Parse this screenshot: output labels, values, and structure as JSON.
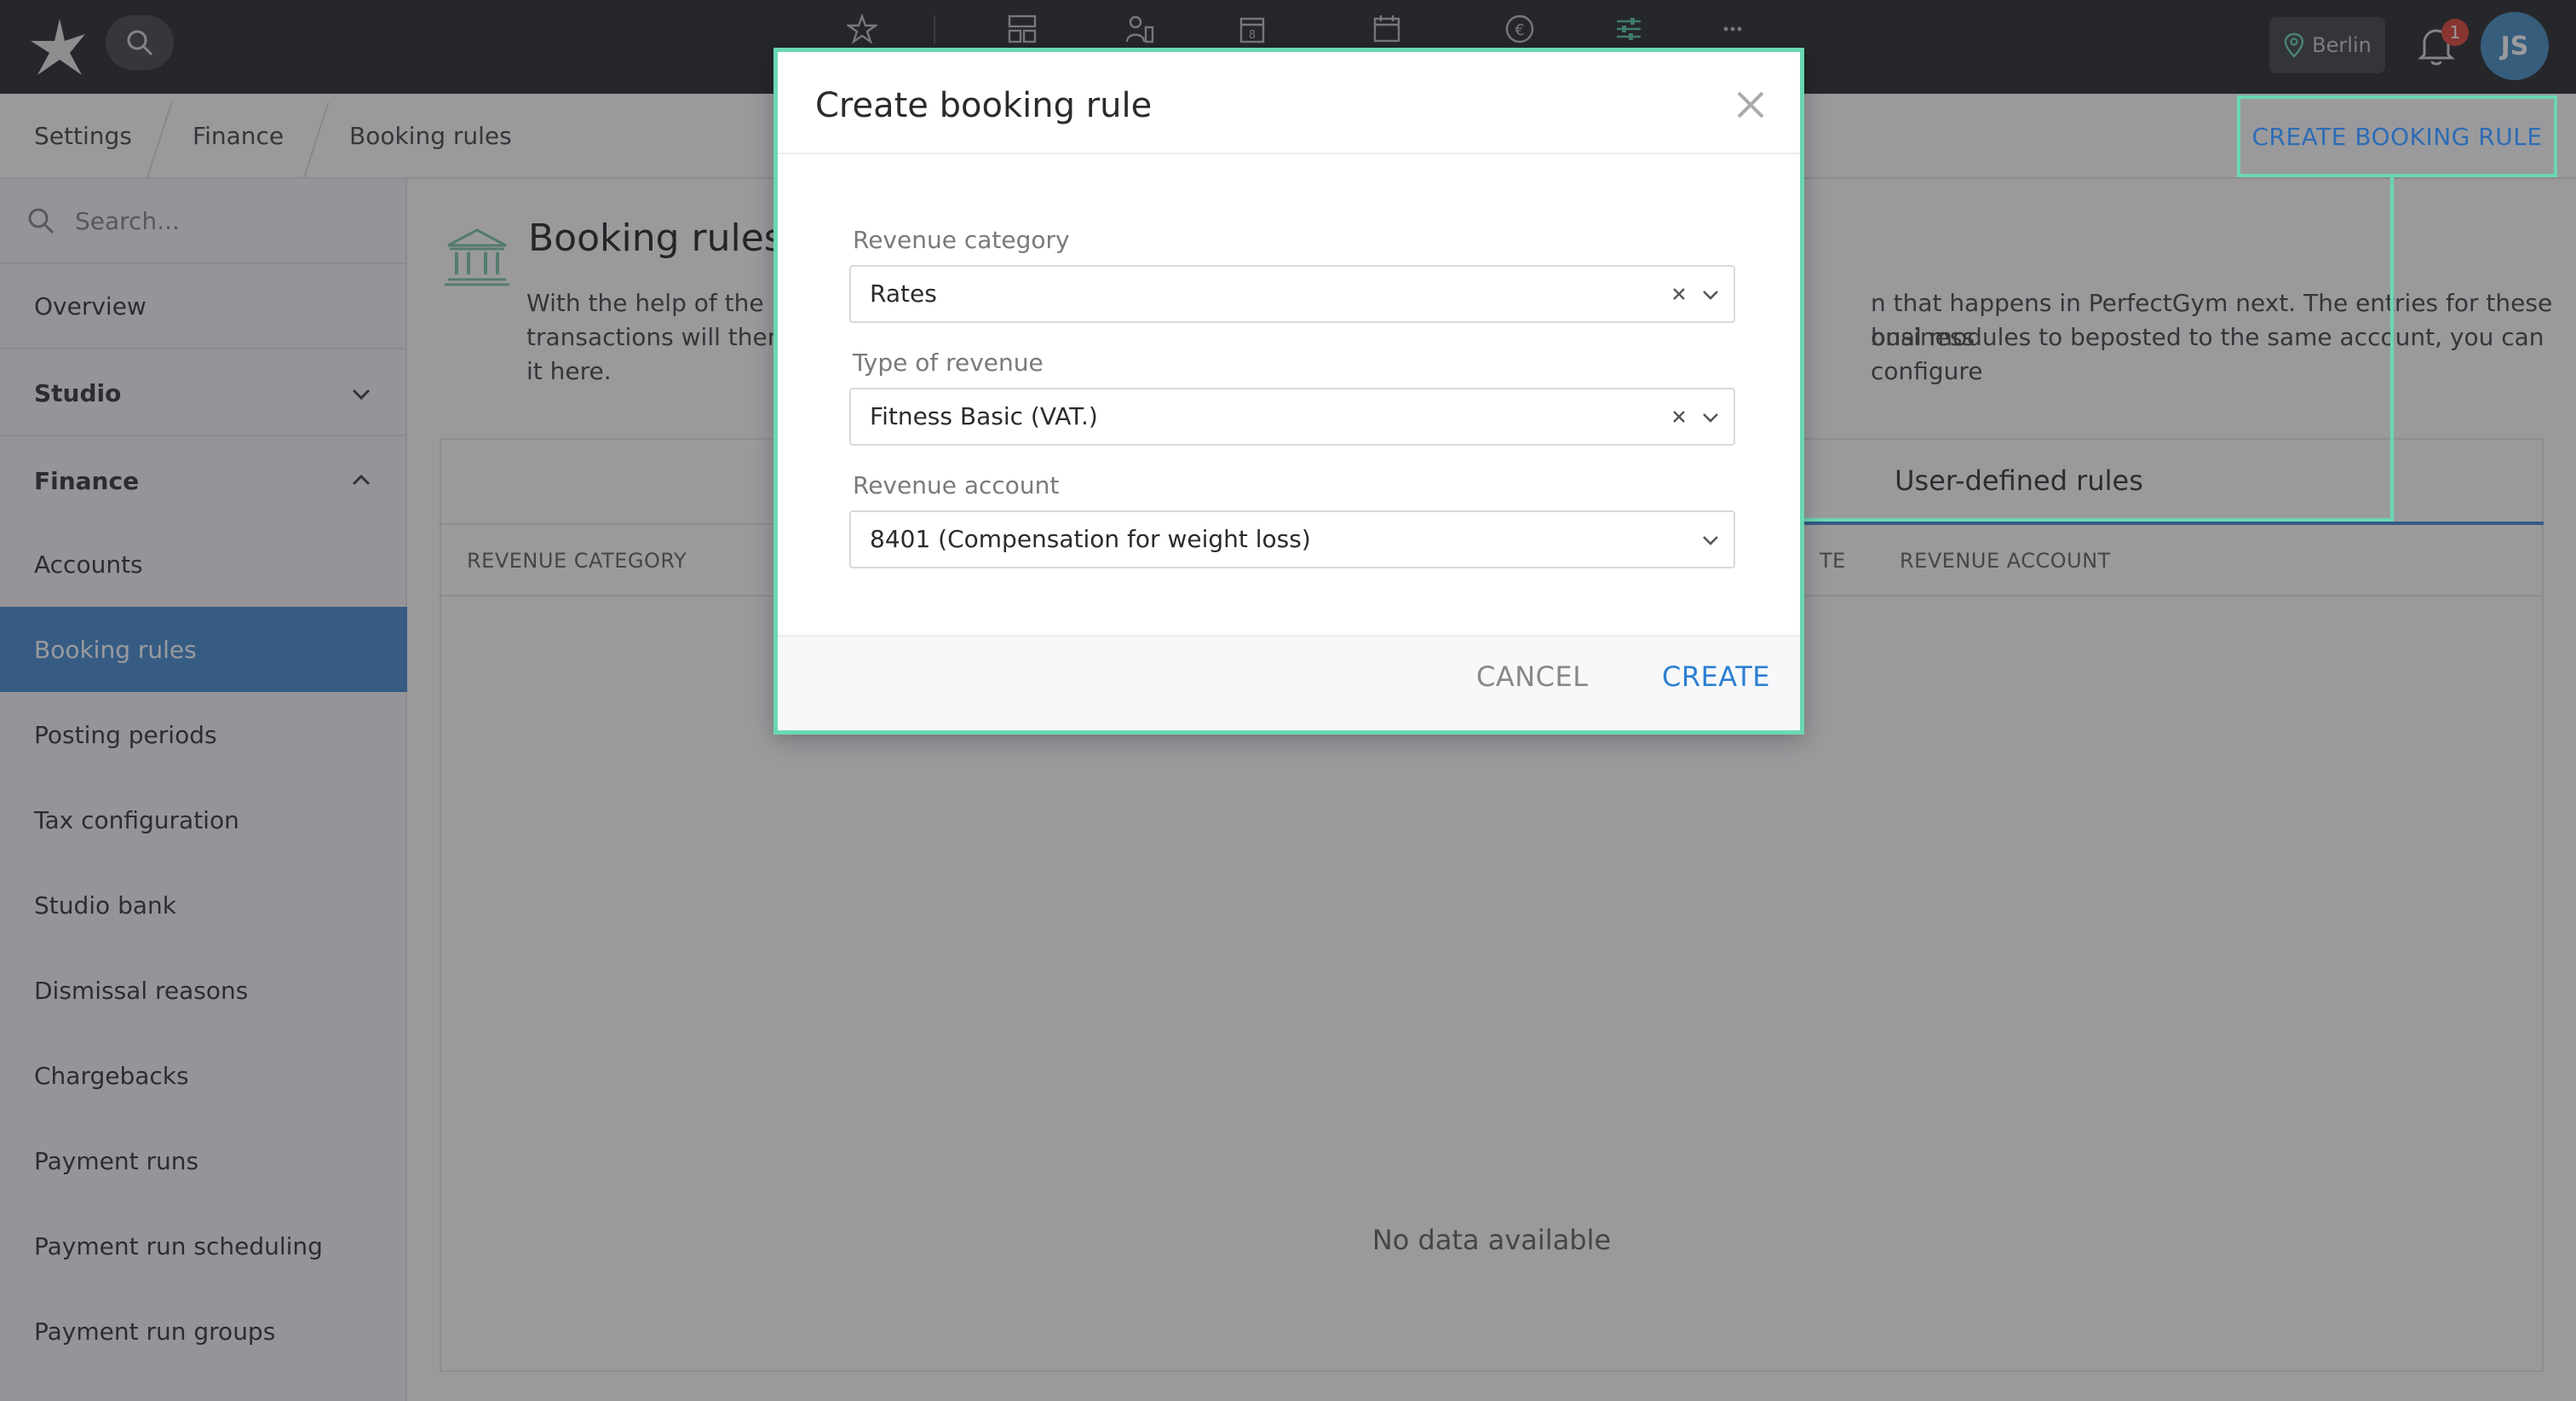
{
  "topbar": {
    "location": "Berlin",
    "notification_count": "1",
    "user_initials": "JS",
    "icons": [
      "logo-star-icon",
      "search-icon",
      "favorites-star-icon",
      "dashboard-icon",
      "members-icon",
      "checkin-icon",
      "calendar-icon",
      "euro-icon",
      "settings-sliders-icon",
      "more-icon",
      "location-pin-icon",
      "bell-icon"
    ]
  },
  "breadcrumb": {
    "items": [
      "Settings",
      "Finance",
      "Booking rules"
    ],
    "action_label": "CREATE BOOKING RULE"
  },
  "sidebar": {
    "search_placeholder": "Search...",
    "items": [
      {
        "label": "Overview"
      },
      {
        "label": "Studio"
      },
      {
        "label": "Finance"
      },
      {
        "label": "Accounts"
      },
      {
        "label": "Booking rules"
      },
      {
        "label": "Posting periods"
      },
      {
        "label": "Tax configuration"
      },
      {
        "label": "Studio bank"
      },
      {
        "label": "Dismissal reasons"
      },
      {
        "label": "Chargebacks"
      },
      {
        "label": "Payment runs"
      },
      {
        "label": "Payment run scheduling"
      },
      {
        "label": "Payment run groups"
      }
    ]
  },
  "main": {
    "title": "Booking rules",
    "description_line1_a": "With the help of the bo",
    "description_line1_b": "n that happens in PerfectGym next. The entries for these business",
    "description_line2_a": "transactions will then e",
    "description_line2_b": "onal modules to beposted to the same account, you can configure",
    "description_line3": "it here.",
    "tab_user_defined": "User-defined rules",
    "columns": {
      "revenue_category": "REVENUE CATEGORY",
      "partial_type": "TE",
      "revenue_account": "REVENUE ACCOUNT"
    },
    "empty_text": "No data available"
  },
  "modal": {
    "title": "Create booking rule",
    "fields": {
      "revenue_category": {
        "label": "Revenue category",
        "value": "Rates"
      },
      "type_of_revenue": {
        "label": "Type of revenue",
        "value": "Fitness Basic (VAT.)"
      },
      "revenue_account": {
        "label": "Revenue account",
        "value": "8401 (Compensation for weight loss)"
      }
    },
    "cancel_label": "CANCEL",
    "create_label": "CREATE"
  },
  "colors": {
    "topbar": "#2c2e31",
    "accent_blue": "#4a8ed1",
    "highlight_green": "#6ad7b3",
    "link_blue": "#2d6cb5"
  }
}
